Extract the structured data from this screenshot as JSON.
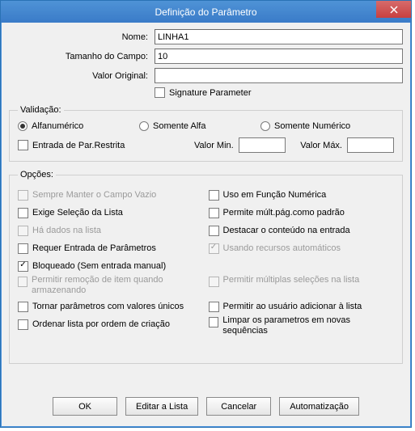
{
  "title": "Definição do Parâmetro",
  "form": {
    "name_label": "Nome:",
    "name_value": "LINHA1",
    "size_label": "Tamanho do Campo:",
    "size_value": "10",
    "original_label": "Valor Original:",
    "original_value": "",
    "signature_label": "Signature Parameter"
  },
  "validation": {
    "legend": "Validação:",
    "radio_alphanumeric": "Alfanumérico",
    "radio_alpha_only": "Somente Alfa",
    "radio_numeric_only": "Somente Numérico",
    "restricted_entry": "Entrada de Par.Restrita",
    "min_label": "Valor Min.",
    "min_value": "",
    "max_label": "Valor Máx.",
    "max_value": ""
  },
  "options": {
    "legend": "Opções:",
    "left": {
      "always_blank": "Sempre Manter o Campo Vazio",
      "require_list_selection": "Exige Seleção da Lista",
      "has_list_data": "Há dados na lista",
      "require_param_entry": "Requer Entrada de Parâmetros",
      "locked": "Bloqueado (Sem entrada manual)",
      "allow_remove_on_store": "Permitir remoção de item quando armazenando",
      "unique_params": "Tornar parâmetros com valores únicos",
      "order_by_creation": "Ordenar lista por ordem de criação"
    },
    "right": {
      "numeric_function": "Uso em Função Numérica",
      "multi_page_default": "Permite múlt.pág.como padrão",
      "highlight_on_entry": "Destacar o conteúdo na entrada",
      "auto_resources": "Usando recursos automáticos",
      "multi_select": "Permitir múltiplas seleções na lista",
      "user_add_to_list": "Permitir ao usuário adicionar à lista",
      "clear_new_seq": "Limpar os parametros em novas sequências"
    }
  },
  "buttons": {
    "ok": "OK",
    "edit_list": "Editar a Lista",
    "cancel": "Cancelar",
    "automation": "Automatização"
  }
}
